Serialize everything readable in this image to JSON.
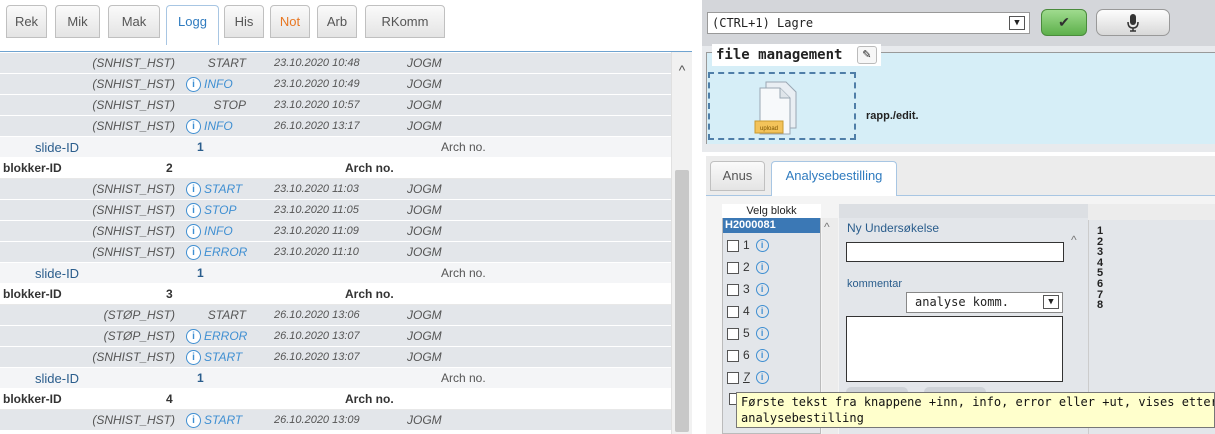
{
  "tabs": [
    {
      "label": "Rek"
    },
    {
      "label": "Mik"
    },
    {
      "label": "Mak"
    },
    {
      "label": "Logg"
    },
    {
      "label": "His"
    },
    {
      "label": "Not"
    },
    {
      "label": "Arb"
    },
    {
      "label": "RKomm"
    }
  ],
  "active_tab": "Logg",
  "log_rows": [
    {
      "kind": "log",
      "src": "(SNHIST_HST)",
      "icon": false,
      "type": "START",
      "date": "23.10.2020 10:48",
      "user": "JOGM"
    },
    {
      "kind": "log",
      "src": "(SNHIST_HST)",
      "icon": true,
      "type": "INFO",
      "date": "23.10.2020 10:49",
      "user": "JOGM"
    },
    {
      "kind": "log",
      "src": "(SNHIST_HST)",
      "icon": false,
      "type": "STOP",
      "date": "23.10.2020 10:57",
      "user": "JOGM"
    },
    {
      "kind": "log",
      "src": "(SNHIST_HST)",
      "icon": true,
      "type": "INFO",
      "date": "26.10.2020 13:17",
      "user": "JOGM"
    },
    {
      "kind": "slide",
      "label": "slide-ID",
      "value": "1",
      "arch": "Arch no."
    },
    {
      "kind": "blokk",
      "label": "blokker-ID",
      "value": "2",
      "arch": "Arch no."
    },
    {
      "kind": "log",
      "src": "(SNHIST_HST)",
      "icon": true,
      "type": "START",
      "date": "23.10.2020 11:03",
      "user": "JOGM"
    },
    {
      "kind": "log",
      "src": "(SNHIST_HST)",
      "icon": true,
      "type": "STOP",
      "date": "23.10.2020 11:05",
      "user": "JOGM"
    },
    {
      "kind": "log",
      "src": "(SNHIST_HST)",
      "icon": true,
      "type": "INFO",
      "date": "23.10.2020 11:09",
      "user": "JOGM"
    },
    {
      "kind": "log",
      "src": "(SNHIST_HST)",
      "icon": true,
      "type": "ERROR",
      "date": "23.10.2020 11:10",
      "user": "JOGM"
    },
    {
      "kind": "slide",
      "label": "slide-ID",
      "value": "1",
      "arch": "Arch no."
    },
    {
      "kind": "blokk",
      "label": "blokker-ID",
      "value": "3",
      "arch": "Arch no."
    },
    {
      "kind": "log",
      "src": "(STØP_HST)",
      "icon": false,
      "type": "START",
      "date": "26.10.2020 13:06",
      "user": "JOGM"
    },
    {
      "kind": "log",
      "src": "(STØP_HST)",
      "icon": true,
      "type": "ERROR",
      "date": "26.10.2020 13:07",
      "user": "JOGM"
    },
    {
      "kind": "log",
      "src": "(SNHIST_HST)",
      "icon": true,
      "type": "START",
      "date": "26.10.2020 13:07",
      "user": "JOGM"
    },
    {
      "kind": "slide",
      "label": "slide-ID",
      "value": "1",
      "arch": "Arch no."
    },
    {
      "kind": "blokk",
      "label": "blokker-ID",
      "value": "4",
      "arch": "Arch no."
    },
    {
      "kind": "log",
      "src": "(SNHIST_HST)",
      "icon": true,
      "type": "START",
      "date": "26.10.2020 13:09",
      "user": "JOGM"
    }
  ],
  "toolbar": {
    "action_select": "(CTRL+1) Lagre",
    "save_glyph": "✔",
    "mic_glyph": "🎙"
  },
  "file_management": {
    "legend": "file management",
    "edit_glyph": "✎",
    "upload_label": "upload",
    "rapp_label": "rapp./edit."
  },
  "sub_tabs": [
    {
      "label": "Anus"
    },
    {
      "label": "Analysebestilling"
    }
  ],
  "active_sub_tab": "Analysebestilling",
  "blokk": {
    "header": "Velg blokk",
    "id": "H2000081",
    "items": [
      "1",
      "2",
      "3",
      "4",
      "5",
      "6",
      "7"
    ]
  },
  "form": {
    "ny_label": "Ny Undersøkelse",
    "komm_label": "kommentar",
    "komm_select": "analyse komm."
  },
  "numbers": [
    "1",
    "2",
    "3",
    "4",
    "5",
    "6",
    "7",
    "8"
  ],
  "tooltip": {
    "line1": "Første tekst fra knappene +inn, info, error eller +ut, vises etter blokknr. i",
    "line2": "analysebestilling"
  },
  "colors": {
    "accent": "#2f7bbf",
    "highlight_tab": "#e87722",
    "save_green": "#5db04b",
    "file_bg": "#d6eef7",
    "tooltip_bg": "#ffffcc"
  }
}
